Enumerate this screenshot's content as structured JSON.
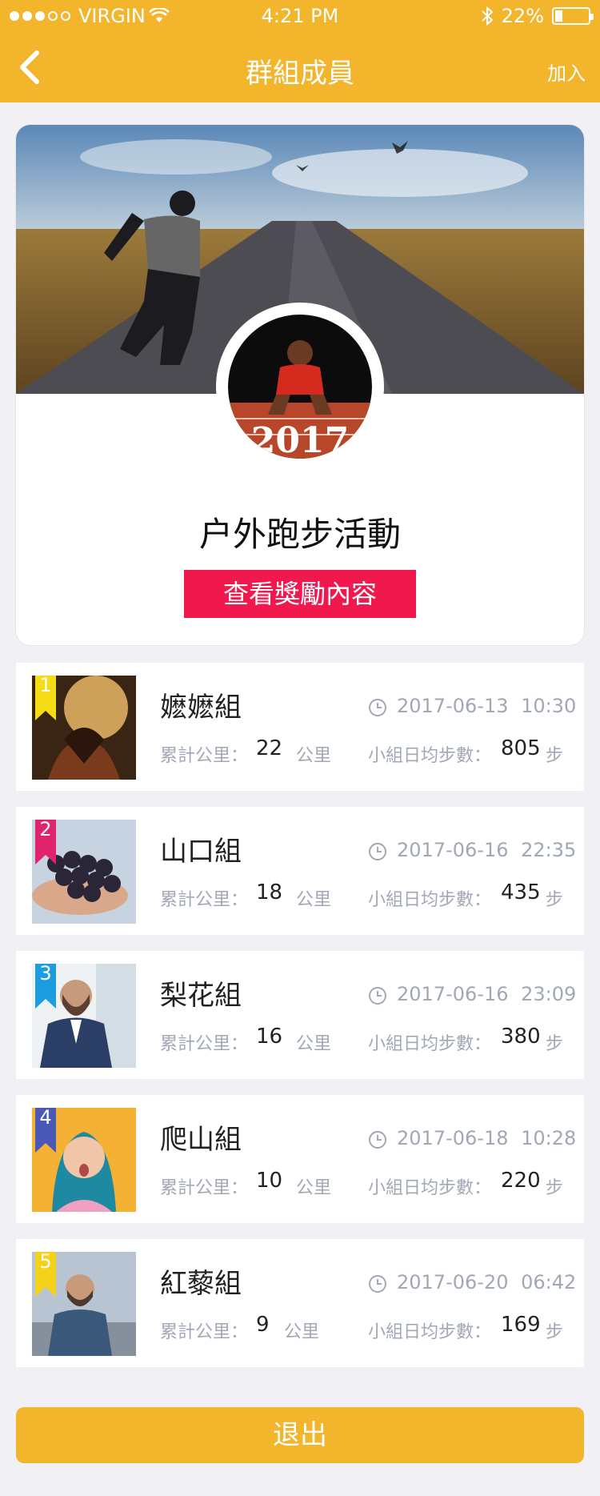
{
  "status_bar": {
    "carrier": "VIRGIN",
    "time": "4:21 PM",
    "battery": "22%",
    "battery_level": 0.22
  },
  "nav": {
    "back_icon": "chevron-left-icon",
    "title": "群組成員",
    "join_label": "加入"
  },
  "profile": {
    "group_name": "户外跑步活動",
    "reward_button": "查看獎勵內容",
    "avatar_year": "2017"
  },
  "labels": {
    "km_label": "累計公里：",
    "km_unit": "公里",
    "steps_label": "小組日均步數：",
    "steps_unit": "步"
  },
  "groups": [
    {
      "rank": "1",
      "name": "嬷嬷組",
      "datetime": "2017-06-13 10:30",
      "km": "22",
      "steps": "805",
      "badge_color": "#f5dc14"
    },
    {
      "rank": "2",
      "name": "山口組",
      "datetime": "2017-06-16 22:35",
      "km": "18",
      "steps": "435",
      "badge_color": "#e0246c"
    },
    {
      "rank": "3",
      "name": "梨花組",
      "datetime": "2017-06-16 23:09",
      "km": "16",
      "steps": "380",
      "badge_color": "#1e9ce0"
    },
    {
      "rank": "4",
      "name": "爬山組",
      "datetime": "2017-06-18 10:28",
      "km": "10",
      "steps": "220",
      "badge_color": "#4a58b8"
    },
    {
      "rank": "5",
      "name": "紅藜組",
      "datetime": "2017-06-20 06:42",
      "km": "9",
      "steps": "169",
      "badge_color": "#f5d21a"
    }
  ],
  "exit_button": "退出",
  "colors": {
    "header": "#f2b52c",
    "reward": "#f0184c",
    "muted": "#a1a8b5"
  }
}
